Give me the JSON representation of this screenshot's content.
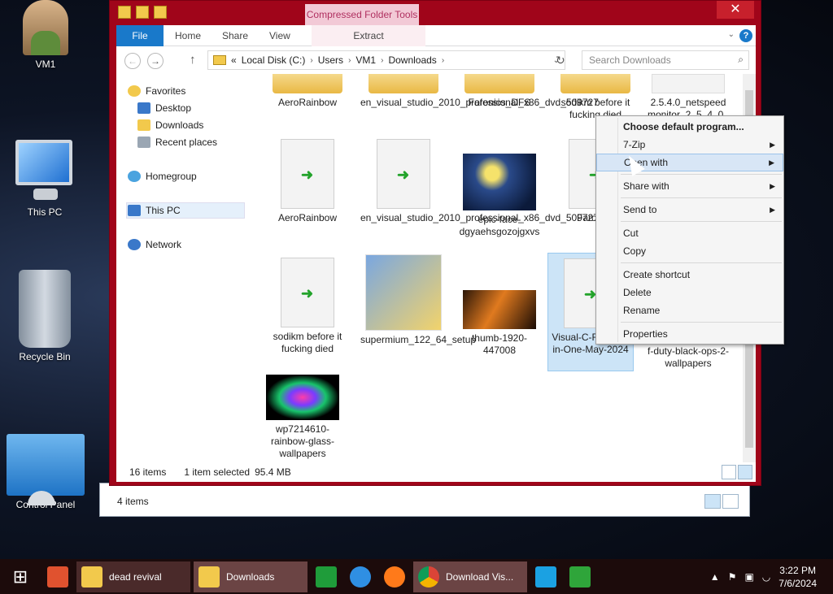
{
  "desktop": {
    "icons": [
      {
        "label": "VM1"
      },
      {
        "label": "This PC"
      },
      {
        "label": "Recycle Bin"
      },
      {
        "label": "Control Panel"
      }
    ]
  },
  "window": {
    "contextual_group": "Compressed Folder Tools",
    "close_label": "✕",
    "ribbon": {
      "file": "File",
      "home": "Home",
      "share": "Share",
      "view": "View",
      "extract": "Extract",
      "help": "?"
    },
    "breadcrumb": [
      "«",
      "Local Disk (C:)",
      "Users",
      "VM1",
      "Downloads"
    ],
    "search_placeholder": "Search Downloads",
    "nav": {
      "favorites": "Favorites",
      "desktop": "Desktop",
      "downloads": "Downloads",
      "recent": "Recent places",
      "homegroup": "Homegroup",
      "thispc": "This PC",
      "network": "Network"
    },
    "files": [
      {
        "name": "AeroRainbow",
        "kind": "folder"
      },
      {
        "name": "en_visual_studio_2010_professional_x86_dvd_509727",
        "kind": "folder"
      },
      {
        "name": "Faronics_DFS",
        "kind": "folder"
      },
      {
        "name": "sodikm before it fucking died",
        "kind": "folder"
      },
      {
        "name": "2.5.4.0_netspeed monitor_2_5_4_0_",
        "kind": "doc"
      },
      {
        "name": "AeroRainbow",
        "kind": "doc"
      },
      {
        "name": "en_visual_studio_2010_professional_x86_dvd_509727",
        "kind": "doc"
      },
      {
        "name": "epic-face-dgyaehsgozojgxvs",
        "kind": "image"
      },
      {
        "name": "Faronics",
        "kind": "doc"
      },
      {
        "name": "sodikm before it fucking died",
        "kind": "doc"
      },
      {
        "name": "supermium_122_64_setup",
        "kind": "installer"
      },
      {
        "name": "thumb-1920-447008",
        "kind": "image"
      },
      {
        "name": "Visual-C-R es-All-in-One-May-2024",
        "kind": "doc"
      },
      {
        "name": "f-duty-black-ops-2-wallpapers",
        "kind": "image"
      },
      {
        "name": "wp7214610-rainbow-glass-wallpapers",
        "kind": "image"
      }
    ],
    "status": {
      "items": "16 items",
      "selected": "1 item selected",
      "size": "95.4 MB"
    },
    "back_status": "4 items"
  },
  "context_menu": [
    {
      "label": "Choose default program...",
      "bold": true
    },
    {
      "label": "7-Zip",
      "submenu": true
    },
    {
      "label": "Open with",
      "submenu": true,
      "hover": true
    },
    {
      "sep": true
    },
    {
      "label": "Share with",
      "submenu": true
    },
    {
      "sep": true
    },
    {
      "label": "Send to",
      "submenu": true
    },
    {
      "sep": true
    },
    {
      "label": "Cut"
    },
    {
      "label": "Copy"
    },
    {
      "sep": true
    },
    {
      "label": "Create shortcut"
    },
    {
      "label": "Delete"
    },
    {
      "label": "Rename"
    },
    {
      "sep": true
    },
    {
      "label": "Properties"
    }
  ],
  "taskbar": {
    "apps": [
      {
        "label": "dead revival"
      },
      {
        "label": "Downloads"
      },
      {
        "label": "Download Vis..."
      }
    ],
    "time": "3:22 PM",
    "date": "7/6/2024"
  }
}
